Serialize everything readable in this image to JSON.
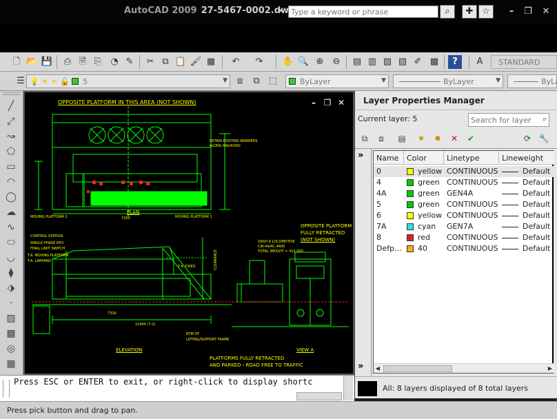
{
  "window": {
    "app_name": "AutoCAD 2009",
    "document": "27-5467-0002.dwg",
    "search_placeholder": "Type a keyword or phrase"
  },
  "toolbar": {
    "text_style": "STANDARD",
    "layer_state_value": "5",
    "color_value": "ByLayer",
    "linetype_value": "ByLayer",
    "lineweight_value": "ByLayer"
  },
  "drawing": {
    "labels": {
      "opposite_platform_not_shown": "OPPOSITE PLATFORM IN THIS AREA (NOT SHOWN)",
      "plan": "PLAN",
      "elevation": "ELEVATION",
      "view_a": "VIEW A",
      "opposite_platform_retracted_1": "OPPOSITE PLATFORM",
      "opposite_platform_retracted_2": "FULLY RETRACTED",
      "opposite_platform_retracted_3": "(NOT SHOWN)",
      "platforms_retracted_1": "PLATFORMS FULLY RETRACTED",
      "platforms_retracted_2": "AND PARKED - ROAD FREE TO TRAFFIC",
      "moving_platform_2": "MOVING PLATFORM 2",
      "moving_platform_1": "MOVING PLATFORM 1",
      "retain_barriers_1": "RETAIN EXISTING BARRIERS",
      "retain_barriers_2": "ALONG RAILROAD",
      "control_station": "CONTROL STATION",
      "single_phase": "SINGLE PHASE EPO",
      "final_limit": "FINAL LIMIT SWITCH",
      "ta_moving": "T.A. MOVING PLATFORM",
      "ta_lanyard": "T.A. LANYARD",
      "ta_fixed": "T.A. FIXED",
      "clearance": "CLEARANCE",
      "lifting_frame_1": "BTM OF",
      "lifting_frame_2": "LIFTING/SUPPORT FRAME",
      "dash8_1": "DASH 8 LOCOMOTIVE",
      "dash8_2": "CW-44/AC-4400",
      "dash8_3": "TOTAL WEIGHT = 415,000",
      "dim_plan": "7200",
      "dim_elev": "11644 (7-2)",
      "dim_elev_2": "7316"
    }
  },
  "layer_manager": {
    "title": "Layer Properties Manager",
    "current_layer_label": "Current layer: 5",
    "search_placeholder": "Search for layer",
    "columns": [
      "Name",
      "Color",
      "Linetype",
      "Lineweight"
    ],
    "layers": [
      {
        "name": "0",
        "color_name": "yellow",
        "color_hex": "#ffff00",
        "linetype": "CONTINUOUS",
        "lineweight": "Default"
      },
      {
        "name": "4",
        "color_name": "green",
        "color_hex": "#00cc00",
        "linetype": "CONTINUOUS",
        "lineweight": "Default"
      },
      {
        "name": "4A",
        "color_name": "green",
        "color_hex": "#00cc00",
        "linetype": "GEN4A",
        "lineweight": "Default"
      },
      {
        "name": "5",
        "color_name": "green",
        "color_hex": "#00cc00",
        "linetype": "CONTINUOUS",
        "lineweight": "Default"
      },
      {
        "name": "6",
        "color_name": "yellow",
        "color_hex": "#ffff00",
        "linetype": "CONTINUOUS",
        "lineweight": "Default"
      },
      {
        "name": "7A",
        "color_name": "cyan",
        "color_hex": "#33dddd",
        "linetype": "GEN7A",
        "lineweight": "Default"
      },
      {
        "name": "8",
        "color_name": "red",
        "color_hex": "#dd2222",
        "linetype": "CONTINUOUS",
        "lineweight": "Default"
      },
      {
        "name": "Defp...",
        "color_name": "40",
        "color_hex": "#ffaa22",
        "linetype": "CONTINUOUS",
        "lineweight": "Default"
      }
    ],
    "status": "All: 8 layers displayed of 8 total layers"
  },
  "command_line": {
    "history": "Press ESC or ENTER to exit, or right-click to display shortc"
  },
  "status_bar": {
    "text": "Press pick button and drag to pan."
  },
  "colors": {
    "drawing_green": "#00ff00",
    "drawing_yellow": "#ffff00",
    "drawing_red": "#ff2020"
  }
}
